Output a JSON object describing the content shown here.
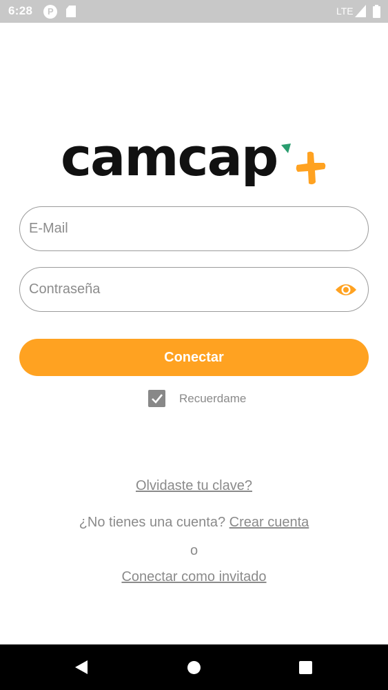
{
  "status_bar": {
    "time": "6:28",
    "network": "LTE",
    "icons": [
      "p-notification-icon",
      "sd-card-icon",
      "signal-icon",
      "battery-icon"
    ]
  },
  "logo": {
    "text": "camcap",
    "plus_color": "#ffa221",
    "accent_color": "#2a9d6f"
  },
  "login": {
    "email_placeholder": "E-Mail",
    "email_value": "",
    "password_placeholder": "Contraseña",
    "password_value": "",
    "show_password_icon": "eye-icon",
    "connect_label": "Conectar",
    "remember_label": "Recuerdame",
    "remember_checked": true
  },
  "links": {
    "forgot": "Olvidaste tu clave?",
    "no_account_prompt": "¿No tienes una cuenta?",
    "create_account": "Crear cuenta",
    "or": "o",
    "guest": "Conectar como invitado"
  },
  "colors": {
    "accent": "#ffa221",
    "text_muted": "#8a8a8a",
    "field_border": "#9a9a9a"
  },
  "nav_bar": {
    "icons": [
      "back-icon",
      "home-icon",
      "recents-icon"
    ]
  }
}
